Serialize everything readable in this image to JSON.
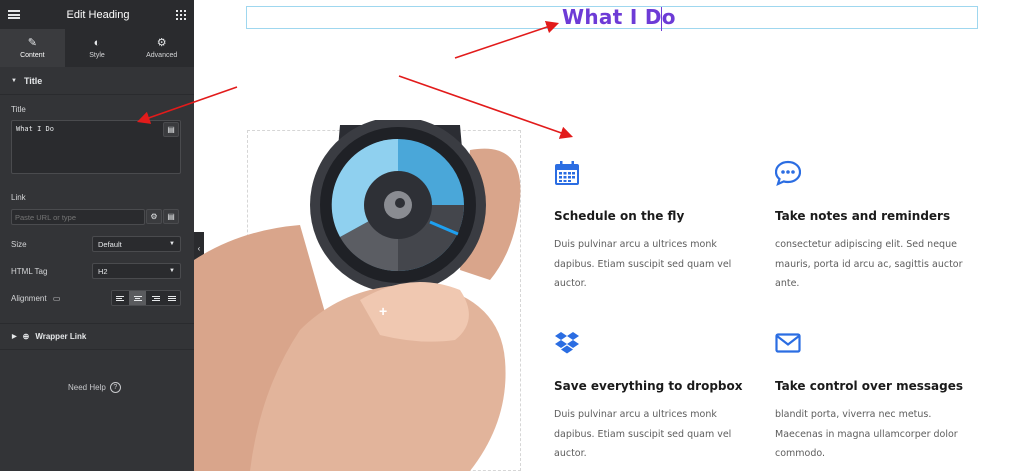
{
  "panel": {
    "header_title": "Edit Heading",
    "tabs": [
      {
        "label": "Content",
        "icon": "pencil-icon"
      },
      {
        "label": "Style",
        "icon": "half-circle-icon"
      },
      {
        "label": "Advanced",
        "icon": "gear-icon"
      }
    ],
    "section_title": "Title",
    "title_label": "Title",
    "title_value": "What I Do",
    "link_label": "Link",
    "link_placeholder": "Paste URL or type",
    "size_label": "Size",
    "size_value": "Default",
    "html_tag_label": "HTML Tag",
    "html_tag_value": "H2",
    "alignment_label": "Alignment",
    "alignment_options": [
      "left",
      "center",
      "right",
      "justify"
    ],
    "alignment_selected": "center",
    "wrapper_link_label": "Wrapper Link",
    "need_help_label": "Need Help",
    "colors": {
      "panel_bg": "#333437",
      "header_bg": "#2a2b2e"
    }
  },
  "canvas": {
    "heading": "What I Do",
    "heading_color": "#6d3bd6",
    "accent_color": "#2b6de2",
    "features": [
      {
        "title": "Schedule on the fly",
        "icon": "calendar-icon",
        "description": "Duis pulvinar arcu a ultrices monk dapibus. Etiam suscipit sed quam vel auctor."
      },
      {
        "title": "Take notes and reminders",
        "icon": "chat-bubble-icon",
        "description": "consectetur adipiscing elit. Sed neque mauris, porta id arcu ac, sagittis auctor ante."
      },
      {
        "title": "Save everything to dropbox",
        "icon": "dropbox-icon",
        "description": "Duis pulvinar arcu a ultrices monk dapibus. Etiam suscipit sed quam vel auctor."
      },
      {
        "title": "Take control over messages",
        "icon": "envelope-icon",
        "description": "blandit porta, viverra nec metus. Maecenas in magna ullamcorper dolor commodo."
      }
    ]
  }
}
